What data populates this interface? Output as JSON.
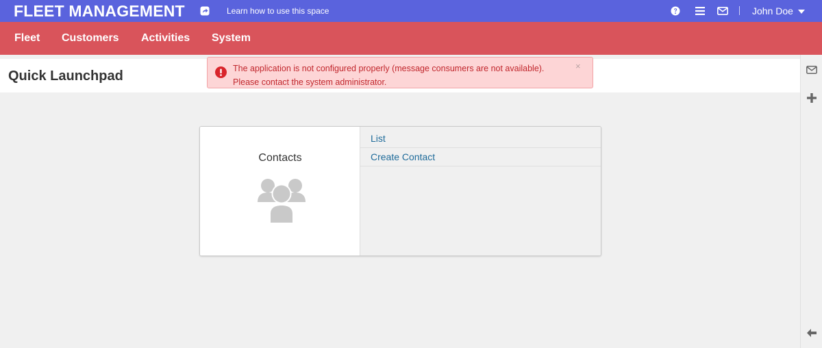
{
  "app": {
    "brand": "FLEET MANAGEMENT",
    "learn_link": "Learn how to use this space",
    "user_name": "John Doe",
    "colors": {
      "topbar": "#5a63dd",
      "mainnav": "#d9545b",
      "alert_bg": "#fdd5d6",
      "alert_text": "#c1272d",
      "link": "#1f6b9a"
    }
  },
  "topbar_icons": [
    "share-icon",
    "help-icon",
    "menu-icon",
    "mail-icon",
    "caret-down-icon"
  ],
  "nav": {
    "items": [
      {
        "label": "Fleet"
      },
      {
        "label": "Customers"
      },
      {
        "label": "Activities"
      },
      {
        "label": "System"
      }
    ]
  },
  "page": {
    "title": "Quick Launchpad"
  },
  "alert": {
    "line1": "The application is not configured properly (message consumers are not available).",
    "line2": "Please contact the system administrator.",
    "close": "×",
    "icon": "exclamation-circle-icon"
  },
  "sidebar_icons": [
    "mail-icon",
    "plus-icon",
    "arrow-left-icon"
  ],
  "launchpad": {
    "card_title": "Contacts",
    "card_icon": "users-icon",
    "links": [
      {
        "label": "List"
      },
      {
        "label": "Create Contact"
      }
    ]
  }
}
